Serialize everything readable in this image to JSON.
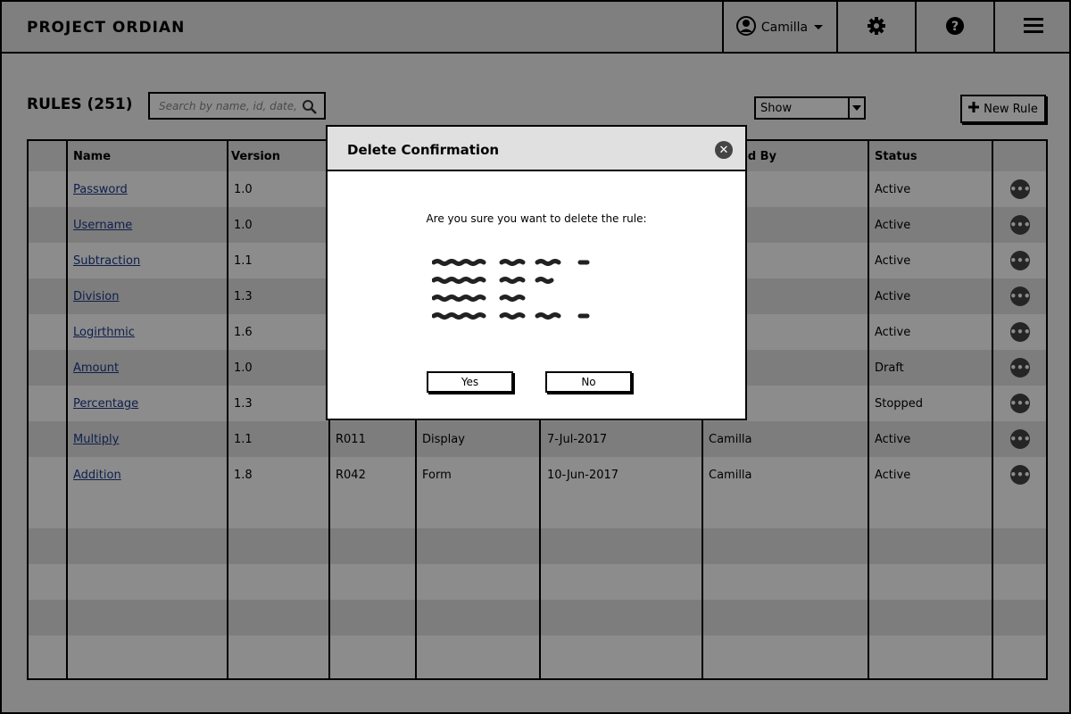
{
  "app": {
    "title": "PROJECT ORDIAN"
  },
  "topbar": {
    "user_name": "Camilla",
    "icons": [
      "user-icon",
      "caret-down-icon",
      "gear-icon",
      "help-icon",
      "hamburger-menu-icon"
    ]
  },
  "toolbar": {
    "rules_title": "RULES (251)",
    "search_placeholder": "Search by name, id, date,...",
    "show_label": "Show",
    "new_rule_label": "New Rule"
  },
  "table": {
    "headers": {
      "name": "Name",
      "version": "Version",
      "modified_by_partial": "ed By",
      "status": "Status"
    },
    "rows": [
      {
        "name": "Password",
        "version": "1.0",
        "id": "",
        "type": "",
        "date": "",
        "modified_by": "",
        "status": "Active"
      },
      {
        "name": "Username",
        "version": "1.0",
        "id": "",
        "type": "",
        "date": "",
        "modified_by": "",
        "status": "Active"
      },
      {
        "name": "Subtraction",
        "version": "1.1",
        "id": "",
        "type": "",
        "date": "",
        "modified_by": "",
        "status": "Active"
      },
      {
        "name": "Division",
        "version": "1.3",
        "id": "",
        "type": "",
        "date": "",
        "modified_by": "",
        "status": "Active"
      },
      {
        "name": "Logirthmic",
        "version": "1.6",
        "id": "",
        "type": "",
        "date": "",
        "modified_by": "",
        "status": "Active"
      },
      {
        "name": "Amount",
        "version": "1.0",
        "id": "",
        "type": "",
        "date": "",
        "modified_by": "",
        "status": "Draft"
      },
      {
        "name": "Percentage",
        "version": "1.3",
        "id": "",
        "type": "",
        "date": "",
        "modified_by": "",
        "status": "Stopped"
      },
      {
        "name": "Multiply",
        "version": "1.1",
        "id": "R011",
        "type": "Display",
        "date": "7-Jul-2017",
        "modified_by": "Camilla",
        "status": "Active"
      },
      {
        "name": "Addition",
        "version": "1.8",
        "id": "R042",
        "type": "Form",
        "date": "10-Jun-2017",
        "modified_by": "Camilla",
        "status": "Active"
      }
    ]
  },
  "modal": {
    "title": "Delete Confirmation",
    "message": "Are you sure you want to delete the rule:",
    "yes_label": "Yes",
    "no_label": "No"
  },
  "colors": {
    "overlay": "#000000",
    "link": "#1a3a8a",
    "row_alt": "#e4e4e4"
  }
}
